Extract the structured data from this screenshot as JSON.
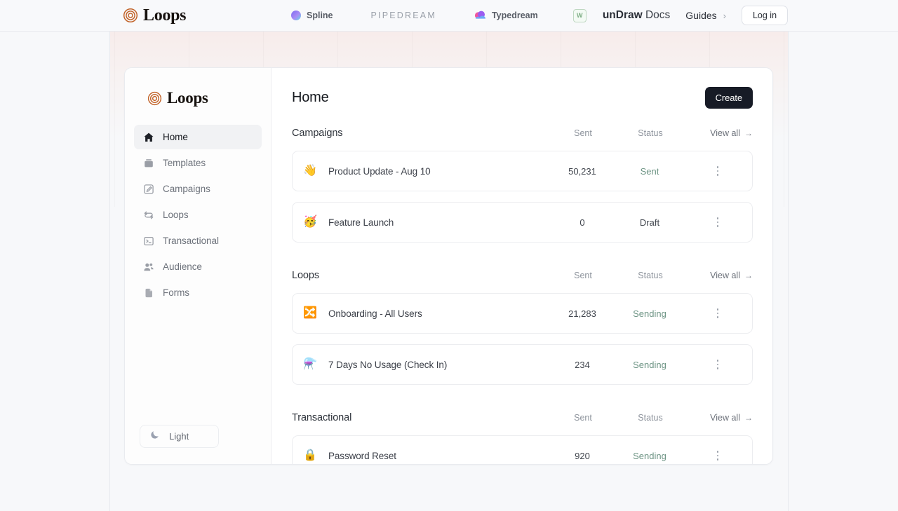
{
  "topnav": {
    "brand": "Loops",
    "brand_logo_icon": "loops-rings-logo",
    "partners": [
      {
        "name": "Spline",
        "icon": "spline-sphere-icon"
      },
      {
        "name": "PIPEDREAM",
        "icon": "pipedream-wordmark"
      },
      {
        "name": "Typedream",
        "icon": "typedream-cloud-icon"
      },
      {
        "name": "W",
        "icon": "framer-w-icon"
      }
    ],
    "undraw_bold": "unDraw",
    "undraw_rest": " Docs",
    "guides": "Guides",
    "guides_chevron": "›",
    "login": "Log in"
  },
  "sidebar": {
    "brand": "Loops",
    "items": [
      {
        "label": "Home",
        "icon": "home-icon",
        "active": true
      },
      {
        "label": "Templates",
        "icon": "templates-icon",
        "active": false
      },
      {
        "label": "Campaigns",
        "icon": "campaigns-edit-icon",
        "active": false
      },
      {
        "label": "Loops",
        "icon": "loops-refresh-icon",
        "active": false
      },
      {
        "label": "Transactional",
        "icon": "transactional-terminal-icon",
        "active": false
      },
      {
        "label": "Audience",
        "icon": "audience-people-icon",
        "active": false
      },
      {
        "label": "Forms",
        "icon": "forms-page-icon",
        "active": false
      }
    ],
    "theme_toggle": {
      "label": "Light",
      "icon": "moon-icon"
    }
  },
  "main": {
    "page_title": "Home",
    "create_label": "Create",
    "columns": {
      "sent": "Sent",
      "status": "Status",
      "view_all": "View all",
      "view_all_arrow": "→"
    },
    "sections": [
      {
        "title": "Campaigns",
        "rows": [
          {
            "emoji": "👋",
            "emoji_name": "waving-hand-emoji",
            "name": "Product Update - Aug 10",
            "sent": "50,231",
            "status": "Sent",
            "status_kind": "sent"
          },
          {
            "emoji": "🥳",
            "emoji_name": "party-face-emoji",
            "name": "Feature Launch",
            "sent": "0",
            "status": "Draft",
            "status_kind": "draft"
          }
        ]
      },
      {
        "title": "Loops",
        "rows": [
          {
            "emoji": "🔀",
            "emoji_name": "shuffle-tracks-emoji",
            "name": "Onboarding - All Users",
            "sent": "21,283",
            "status": "Sending",
            "status_kind": "sending"
          },
          {
            "emoji": "⚗️",
            "emoji_name": "alembic-emoji",
            "name": "7 Days No Usage (Check In)",
            "sent": "234",
            "status": "Sending",
            "status_kind": "sending"
          }
        ]
      },
      {
        "title": "Transactional",
        "rows": [
          {
            "emoji": "🔒",
            "emoji_name": "lock-emoji",
            "name": "Password Reset",
            "sent": "920",
            "status": "Sending",
            "status_kind": "sending"
          }
        ]
      }
    ]
  },
  "colors": {
    "accent_brand": "#c2642a",
    "status_green": "#6d9484",
    "create_button": "#171b26",
    "page_background": "#f7f8fa"
  }
}
